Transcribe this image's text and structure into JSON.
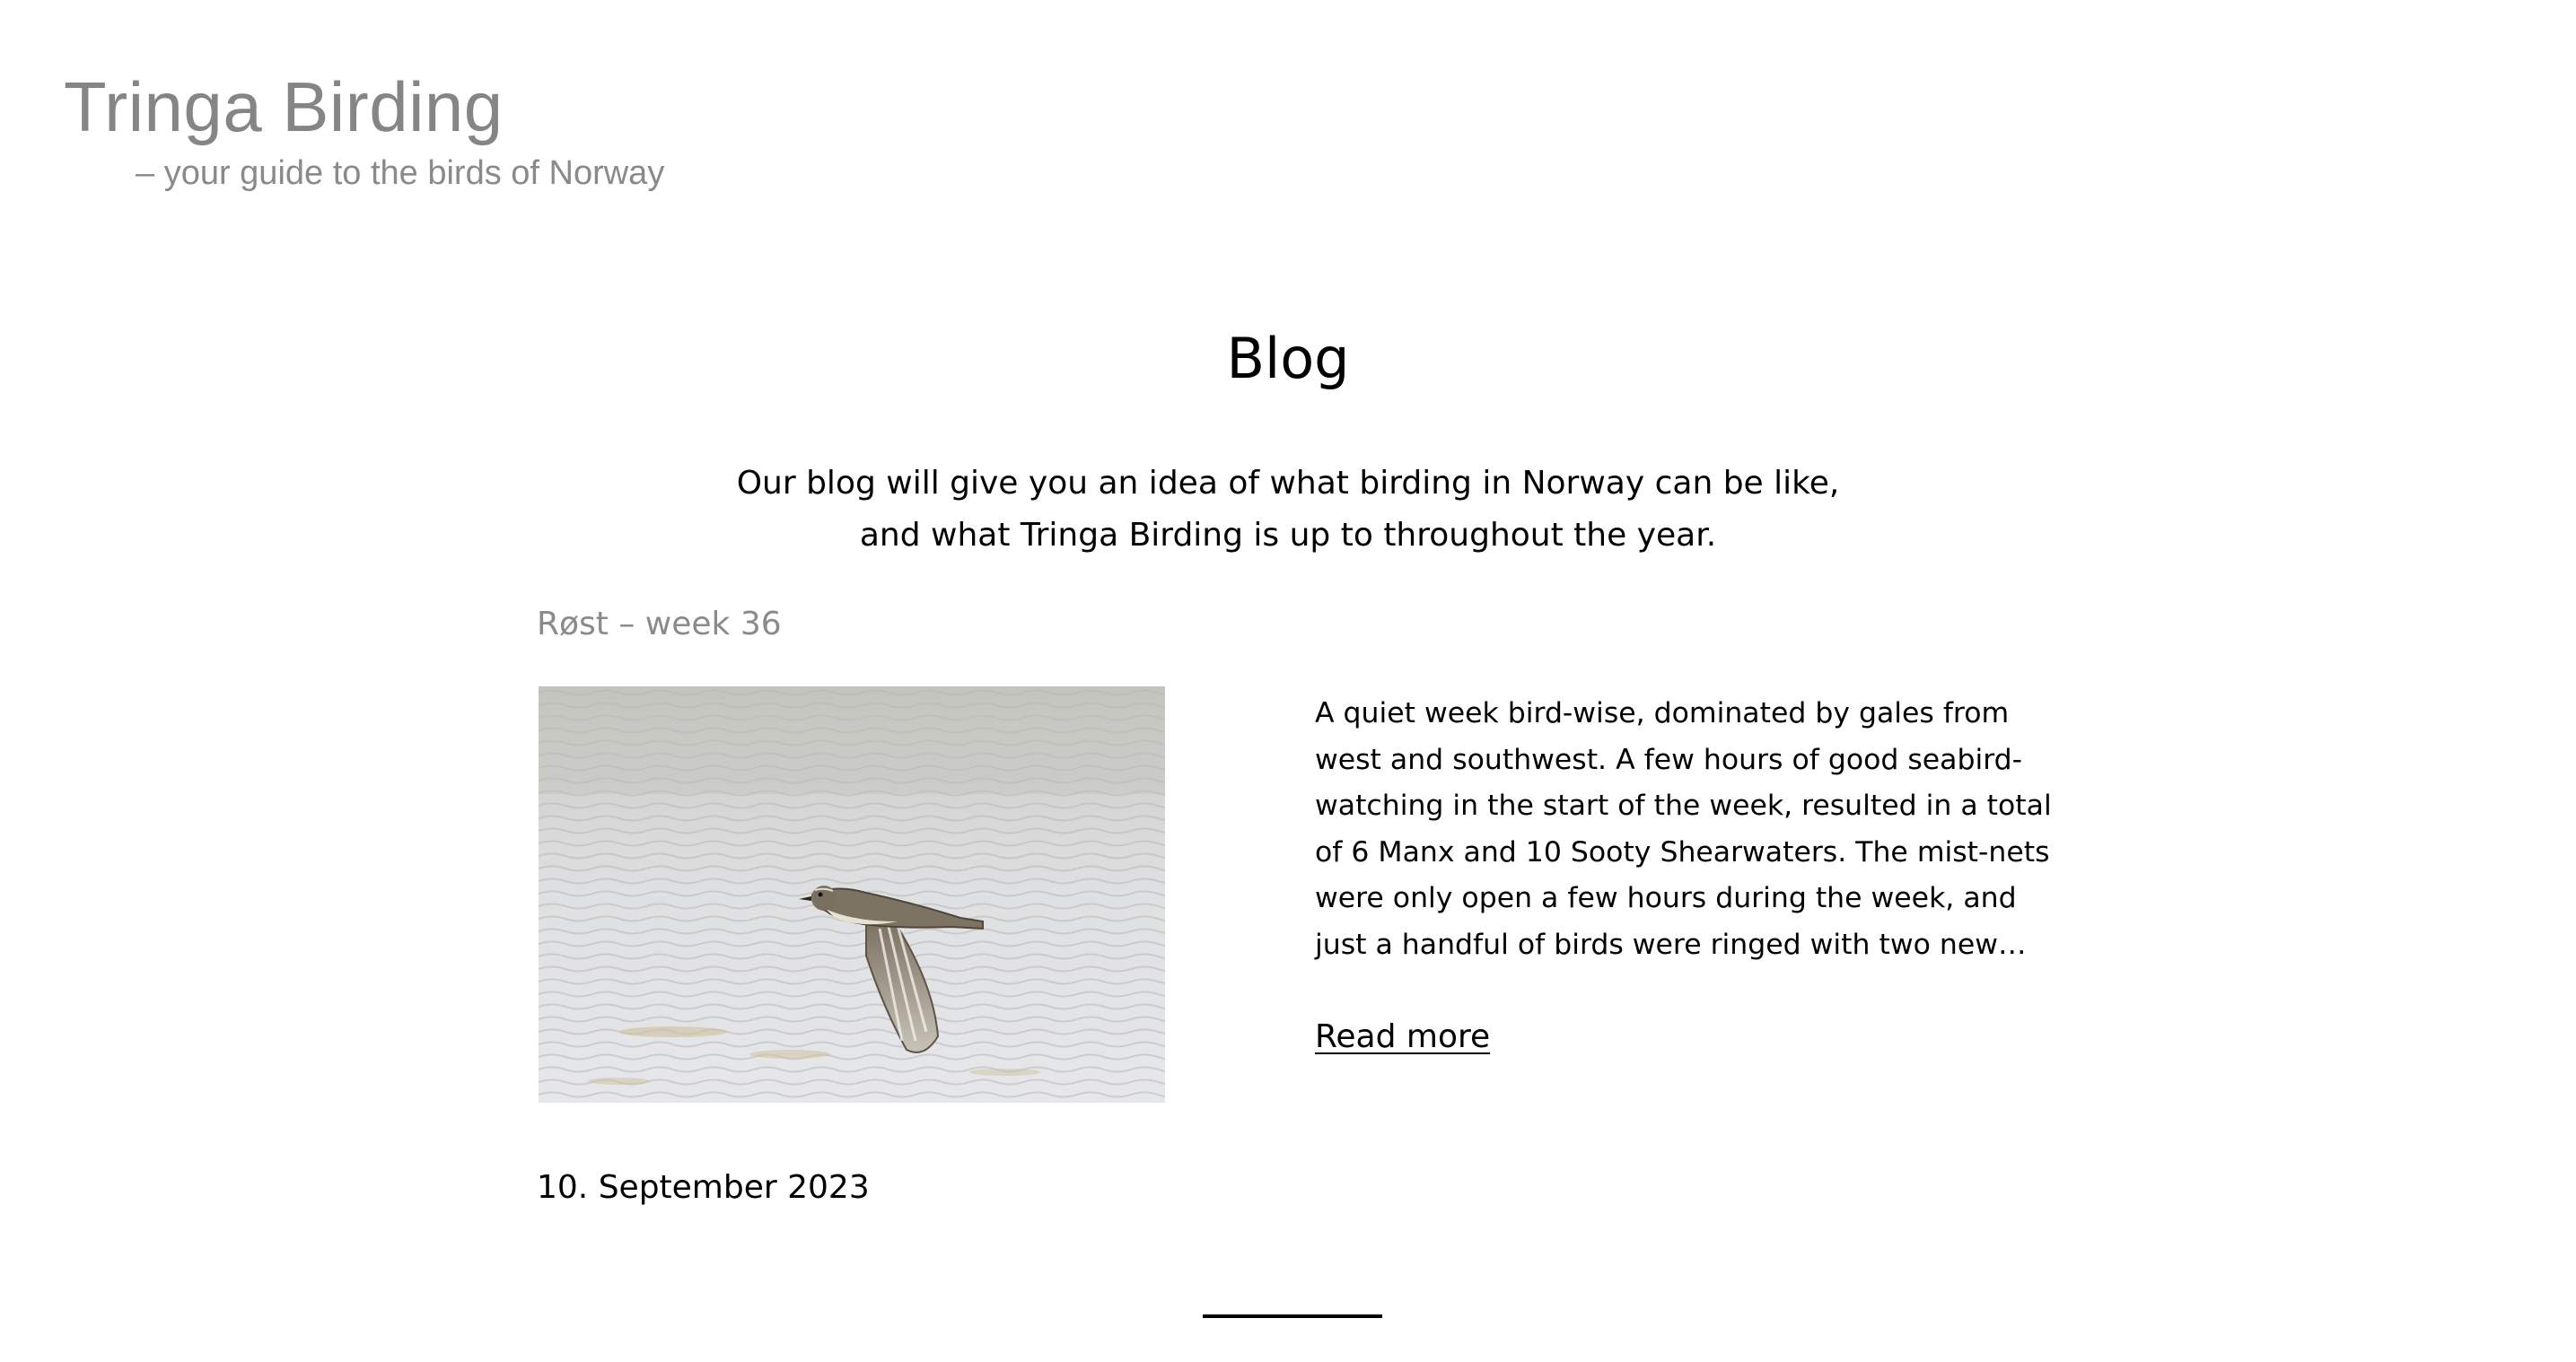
{
  "site": {
    "title": "Tringa Birding",
    "tagline": "– your guide to the birds of Norway"
  },
  "page": {
    "title": "Blog",
    "intro": "Our blog will give you an idea of what birding in Norway can be like, and what Tringa Birding is up to throughout the year."
  },
  "posts": [
    {
      "title": "Røst – week 36",
      "image": "bird-in-flight-over-water-photo",
      "excerpt": "A quiet week bird-wise, dominated by gales from west and southwest. A few hours of good seabird-watching in the start of the week, resulted in a total of 6 Manx and 10 Sooty Shearwaters. The mist-nets were only open a few hours during the week, and just a handful of birds were ringed with two new…",
      "read_more_label": "Read more",
      "date": "10. September 2023"
    }
  ],
  "colors": {
    "logo": "#858585",
    "post_title": "#8a8a8a",
    "text": "#000000",
    "background": "#ffffff"
  }
}
